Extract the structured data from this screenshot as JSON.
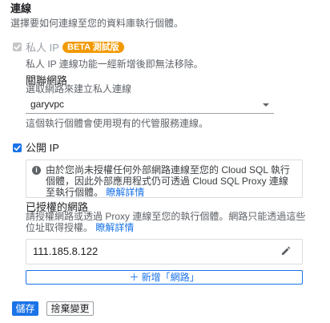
{
  "section": {
    "title": "連線",
    "description": "選擇要如何連線至您的資料庫執行個體。"
  },
  "private_ip": {
    "label": "私人 IP",
    "badge": "BETA 測試版",
    "note": "私人 IP 連線功能一經新增後即無法移除。",
    "assoc_title": "關聯網路",
    "assoc_desc": "選取網路來建立私人連線",
    "network_value": "garyvpc",
    "proxy_note": "這個執行個體會使用現有的代管服務連線。",
    "checked": true,
    "disabled": true
  },
  "public_ip": {
    "label": "公開 IP",
    "checked": true,
    "info_text_1": "由於您尚未授權任何外部網路連線至您的 Cloud SQL 執行個體，因此外部應用程式仍可透過 Cloud SQL Proxy 連線至執行個體。",
    "info_link": "瞭解詳情"
  },
  "authorized_networks": {
    "title": "已授權的網路",
    "desc": "請授權網路或透過 Proxy 連線至您的執行個體。網路只能透過這些位址取得授權。",
    "desc_link": "瞭解詳情",
    "items": [
      {
        "ip": "111.185.8.122"
      }
    ],
    "add_label": "＋ 新增「網路」"
  },
  "actions": {
    "save_label": "儲存",
    "discard_label": "捨棄變更"
  },
  "colors": {
    "primary": "#1a73e8",
    "badge": "#f29900",
    "border": "#dadce0"
  }
}
